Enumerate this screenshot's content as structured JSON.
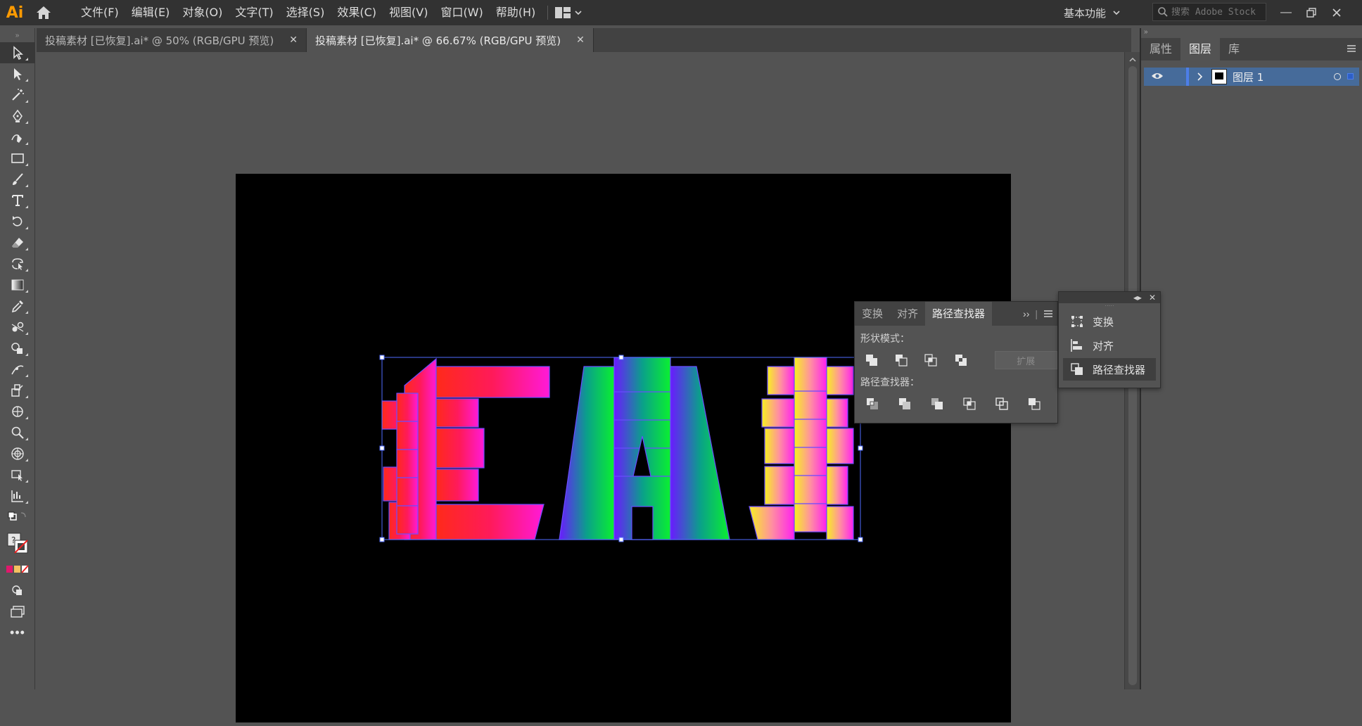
{
  "app": {
    "logo": "Ai",
    "menu": [
      "文件(F)",
      "编辑(E)",
      "对象(O)",
      "文字(T)",
      "选择(S)",
      "效果(C)",
      "视图(V)",
      "窗口(W)",
      "帮助(H)"
    ],
    "workspace": "基本功能",
    "search_placeholder": "搜索 Adobe Stock"
  },
  "tabs": [
    {
      "label": "投稿素材 [已恢复].ai* @ 50% (RGB/GPU 预览)",
      "active": false
    },
    {
      "label": "投稿素材 [已恢复].ai* @ 66.67% (RGB/GPU 预览)",
      "active": true
    }
  ],
  "tools": [
    "selection-tool-icon",
    "direct-selection-tool-icon",
    "magic-wand-tool-icon",
    "pen-tool-icon",
    "curvature-tool-icon",
    "rectangle-tool-icon",
    "paintbrush-tool-icon",
    "type-tool-icon",
    "rotate-tool-icon",
    "eraser-tool-icon",
    "free-transform-tool-icon",
    "gradient-tool-icon",
    "eyedropper-tool-icon",
    "blend-tool-icon",
    "shape-builder-tool-icon",
    "width-tool-icon",
    "scale-tool-icon",
    "symbol-sprayer-tool-icon",
    "zoom-tool-icon",
    "perspective-grid-tool-icon",
    "live-paint-tool-icon",
    "graph-tool-icon"
  ],
  "right_panel": {
    "tabs": [
      "属性",
      "图层",
      "库"
    ],
    "active_tab": "图层",
    "layer_name": "图层 1"
  },
  "pathfinder_panel": {
    "tabs": [
      "变换",
      "对齐",
      "路径查找器"
    ],
    "active_tab": "路径查找器",
    "shape_modes_label": "形状模式：",
    "pathfinders_label": "路径查找器：",
    "expand_label": "扩展"
  },
  "dock_panel": {
    "items": [
      "变换",
      "对齐",
      "路径查找器"
    ],
    "active": "路径查找器"
  },
  "colors": {
    "accent": "#466b9a",
    "layer_color": "#4d7ee8",
    "logo": "#ff9a00"
  }
}
